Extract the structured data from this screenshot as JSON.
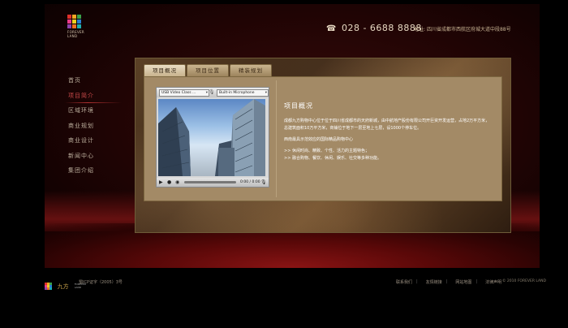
{
  "brand": {
    "logo_text_1": "FOREVER",
    "logo_text_2": "LAND",
    "logo_colors": [
      "#e0302b",
      "#f5a623",
      "#3aa14a",
      "#e83a8a",
      "#f0d020",
      "#2a7fd0",
      "#8e44ad",
      "#f07020",
      "#20b0b0"
    ]
  },
  "header": {
    "phone": "028 - 6688 8888",
    "address_label": "地址:",
    "address": "四川省成都市西航区府城大道中段88号"
  },
  "nav": {
    "items": [
      {
        "label": "首页"
      },
      {
        "label": "项目简介",
        "active": true
      },
      {
        "label": "区域环境"
      },
      {
        "label": "商业规划"
      },
      {
        "label": "商业设计"
      },
      {
        "label": "新闻中心"
      },
      {
        "label": "集团介绍"
      }
    ]
  },
  "tabs": [
    {
      "label": "项目概况",
      "active": true
    },
    {
      "label": "项目位置"
    },
    {
      "label": "精装规划"
    }
  ],
  "player": {
    "camera": "USB Video Class ...",
    "microphone": "Built-in Microphone",
    "time": "0:00 / 0:00",
    "mic_icon": "microphone-icon",
    "play_icon": "play-icon",
    "record_icon": "record-icon",
    "volume_icon": "volume-icon"
  },
  "info": {
    "title": "项目概况",
    "para1": "成都九方购物中心位于位于四川省成都市的天府新城，由中航地产股份有限公司开巨资开发运营，占地2万平方米，总建筑面积10万平方米，商铺位于地下一层至地上七层，设1000个停车位。",
    "para2": "西南最具示范效应的国际精品购物中心",
    "bullet1": ">>  休闲时尚、精致、个性、活力的主题特色；",
    "bullet2": ">>  融合购物、餐饮、休闲、娱乐、社交等多种功能。"
  },
  "footer": {
    "brand": "九方",
    "brand_sub_1": "FOREVER",
    "brand_sub_2": "LAND",
    "icp": "蜀ICP证字（2005）3号",
    "links": [
      "联系我们",
      "友情链接",
      "网站地图",
      "法律声明"
    ],
    "copyright": "© 2010  FOREVER  LAND"
  }
}
